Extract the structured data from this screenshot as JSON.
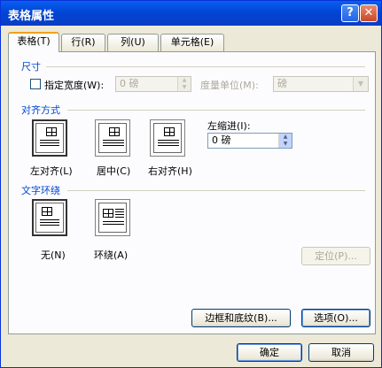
{
  "window": {
    "title": "表格属性",
    "help_icon": "?",
    "close_icon": "✕"
  },
  "tabs": [
    {
      "label": "表格(T)"
    },
    {
      "label": "行(R)"
    },
    {
      "label": "列(U)"
    },
    {
      "label": "单元格(E)"
    }
  ],
  "size": {
    "section": "尺寸",
    "preferred_width_label": "指定宽度(W):",
    "width_value": "0 磅",
    "unit_label": "度量单位(M):",
    "unit_value": "磅"
  },
  "alignment": {
    "section": "对齐方式",
    "left_label": "左对齐(L)",
    "center_label": "居中(C)",
    "right_label": "右对齐(H)",
    "indent_label": "左缩进(I):",
    "indent_value": "0 磅"
  },
  "wrapping": {
    "section": "文字环绕",
    "none_label": "无(N)",
    "around_label": "环绕(A)",
    "position_button": "定位(P)..."
  },
  "panel_buttons": {
    "borders": "边框和底纹(B)...",
    "options": "选项(O)..."
  },
  "dialog_buttons": {
    "ok": "确定",
    "cancel": "取消"
  }
}
